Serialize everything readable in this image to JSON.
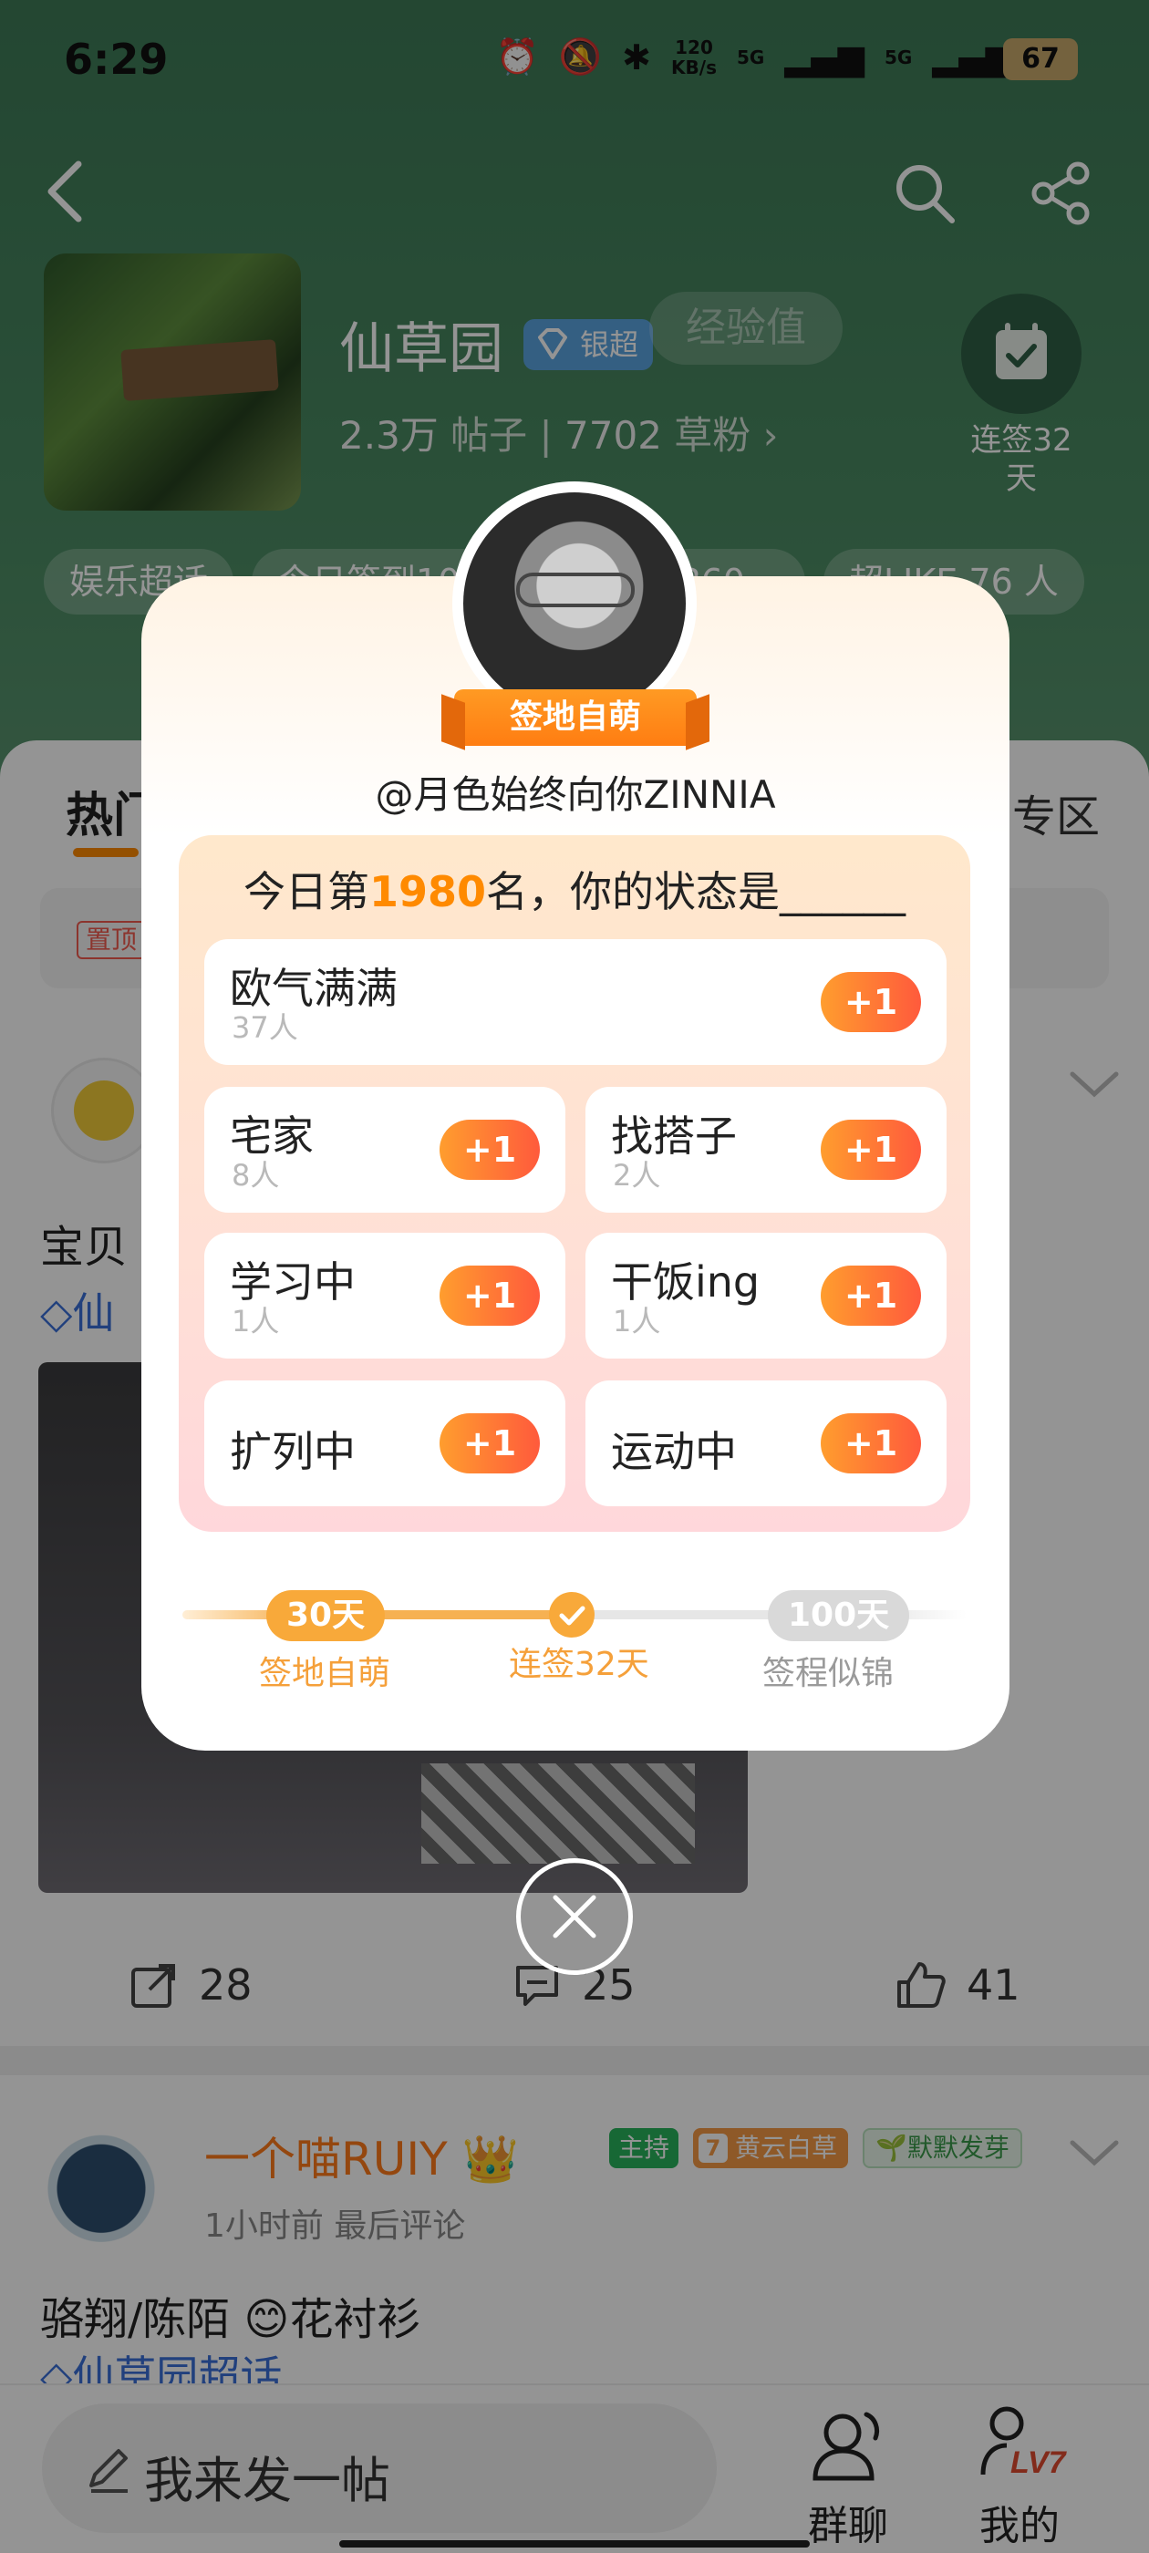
{
  "status_bar": {
    "time": "6:29",
    "network_speed": "120\nKB/s",
    "signal_1": "5G",
    "signal_2": "5G",
    "battery": "67"
  },
  "group": {
    "name": "仙草园",
    "tier_badge": "银超",
    "exp_label": "经验值",
    "posts": "2.3万",
    "posts_label": "帖子",
    "fans": "7702",
    "fans_label": "草粉",
    "checkin_label": "连签32\n天",
    "tags": [
      "娱乐超话",
      "今日签到10…",
      "时热度 860…",
      "超LIKE 76 人"
    ]
  },
  "tabs": {
    "hot": "热门",
    "zone": "专区"
  },
  "pinned_tag": "置顶",
  "post1": {
    "text": "宝贝",
    "group_link": "仙",
    "shares": "28",
    "comments": "25",
    "likes": "41"
  },
  "post2": {
    "author": "一个喵RUIY",
    "badge_host": "主持",
    "badge_level_num": "7",
    "badge_level": "黄云白草",
    "badge_sprout": "默默发芽",
    "meta": "1小时前 最后评论",
    "text": "骆翔/陈陌 😊花衬衫",
    "group_link": "仙草园超话"
  },
  "bottom_nav": {
    "compose_placeholder": "我来发一帖",
    "group_chat": "群聊",
    "mine": "我的",
    "level": "LV7"
  },
  "modal": {
    "badge": "签地自萌",
    "username": "@月色始终向你ZINNIA",
    "title_prefix": "今日第",
    "rank": "1980",
    "title_suffix": "名，你的状态是______",
    "plus_label": "+1",
    "options": [
      {
        "label": "欧气满满",
        "count": "37人"
      },
      {
        "label": "宅家",
        "count": "8人"
      },
      {
        "label": "找搭子",
        "count": "2人"
      },
      {
        "label": "学习中",
        "count": "1人"
      },
      {
        "label": "干饭ing",
        "count": "1人"
      },
      {
        "label": "扩列中",
        "count": ""
      },
      {
        "label": "运动中",
        "count": ""
      }
    ],
    "milestones": [
      {
        "pill": "30天",
        "label": "签地自萌"
      },
      {
        "pill": "",
        "label": "连签32天"
      },
      {
        "pill": "100天",
        "label": "签程似锦"
      }
    ],
    "colors": {
      "accent": "#ff8a00",
      "button_start": "#ff9d2e",
      "button_end": "#ff5a3c"
    }
  }
}
